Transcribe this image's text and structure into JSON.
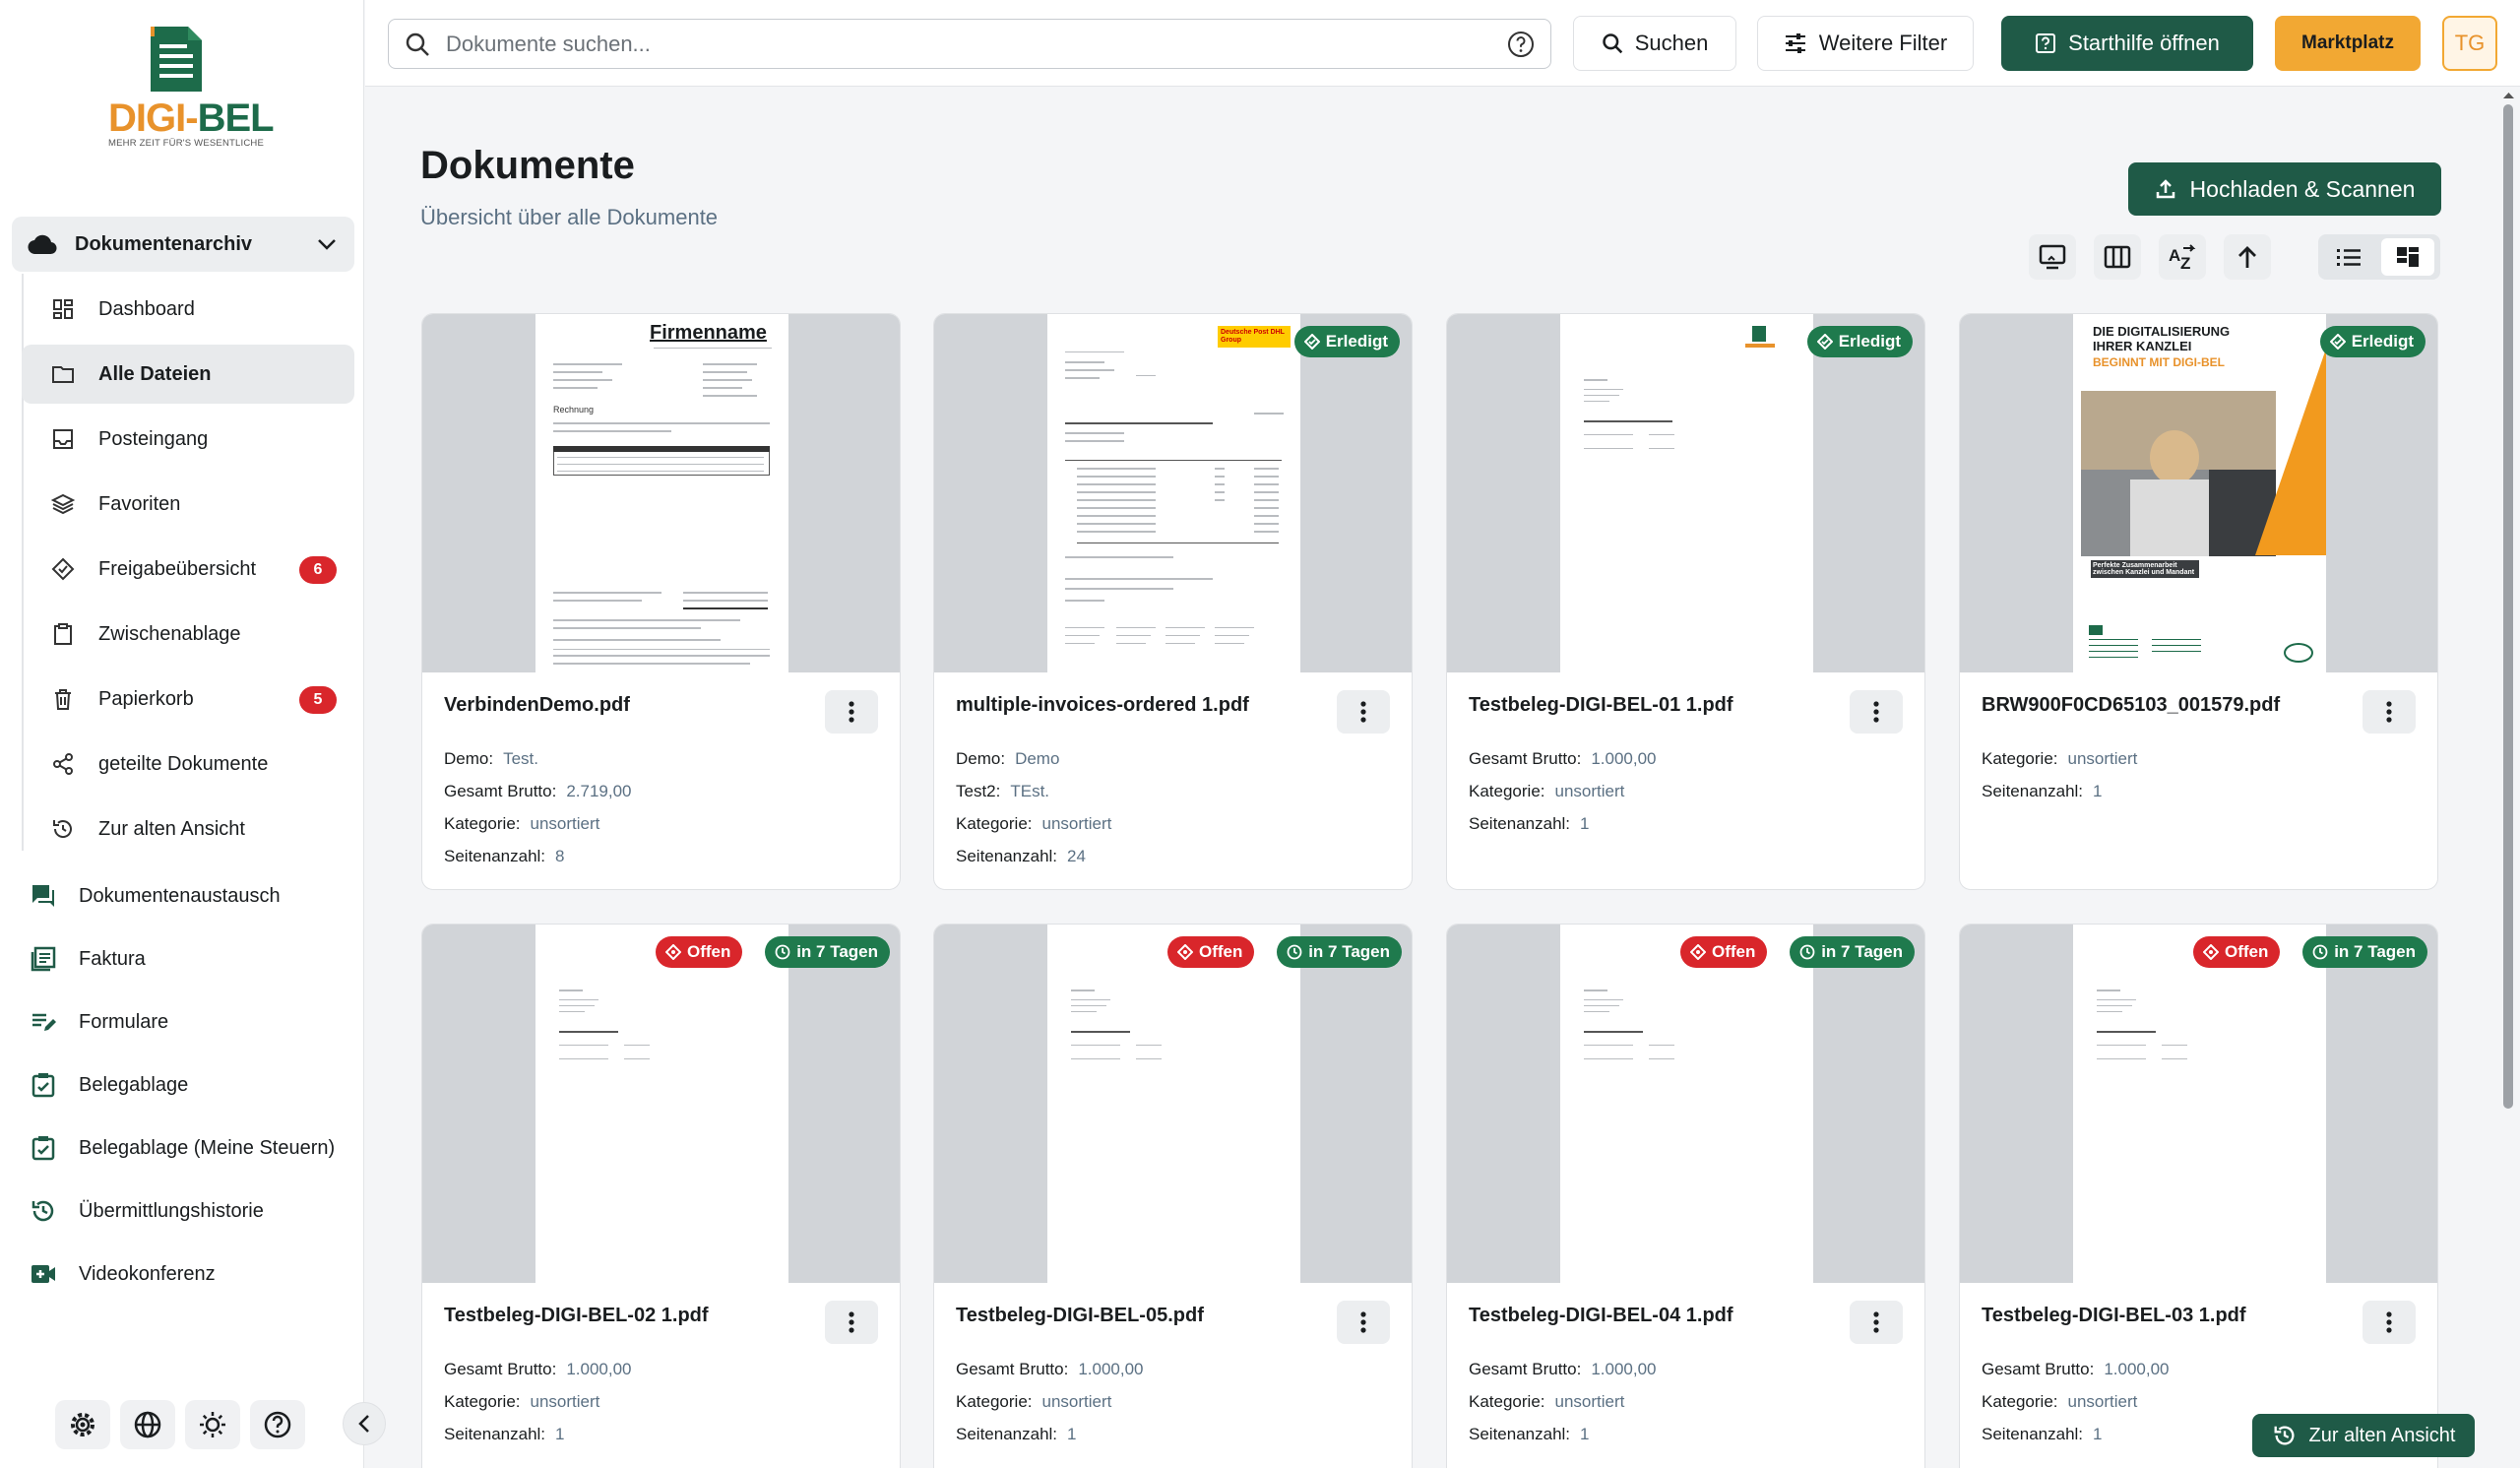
{
  "brand": {
    "logo_a": "DIGI",
    "logo_sep": "-",
    "logo_b": "BEL",
    "tagline": "MEHR ZEIT FÜR'S WESENTLICHE"
  },
  "sidebar": {
    "group": {
      "label": "Dokumentenarchiv",
      "icon": "cloud-icon"
    },
    "sub_items": [
      {
        "label": "Dashboard",
        "icon": "dashboard-icon"
      },
      {
        "label": "Alle Dateien",
        "icon": "folder-icon",
        "active": true
      },
      {
        "label": "Posteingang",
        "icon": "inbox-icon"
      },
      {
        "label": "Favoriten",
        "icon": "layers-icon"
      },
      {
        "label": "Freigabeübersicht",
        "icon": "tag-icon",
        "badge": "6"
      },
      {
        "label": "Zwischenablage",
        "icon": "clipboard-icon"
      },
      {
        "label": "Papierkorb",
        "icon": "trash-icon",
        "badge": "5"
      },
      {
        "label": "geteilte Dokumente",
        "icon": "share-icon"
      },
      {
        "label": "Zur alten Ansicht",
        "icon": "history-icon"
      }
    ],
    "top_items": [
      {
        "label": "Dokumentenaustausch",
        "icon": "chat-icon"
      },
      {
        "label": "Faktura",
        "icon": "invoice-icon"
      },
      {
        "label": "Formulare",
        "icon": "form-icon"
      },
      {
        "label": "Belegablage",
        "icon": "receipt-icon"
      },
      {
        "label": "Belegablage (Meine Steuern)",
        "icon": "receipt-icon"
      },
      {
        "label": "Übermittlungshistorie",
        "icon": "history-icon"
      },
      {
        "label": "Videokonferenz",
        "icon": "video-icon"
      }
    ]
  },
  "topbar": {
    "search_placeholder": "Dokumente suchen...",
    "search_button": "Suchen",
    "filter_button": "Weitere Filter",
    "help_button": "Starthilfe öffnen",
    "market_button": "Marktplatz",
    "avatar": "TG"
  },
  "main": {
    "title": "Dokumente",
    "subtitle": "Übersicht über alle Dokumente",
    "upload_button": "Hochladen & Scannen",
    "old_view_button": "Zur alten Ansicht"
  },
  "labels": {
    "done": "Erledigt",
    "open": "Offen",
    "due": "in 7 Tagen",
    "thumb_company": "Firmenname",
    "thumb_invoice": "Rechnung",
    "thumb_dhl": "Deutsche Post DHL Group",
    "flyer_title": "DIE DIGITALISIERUNG IHRER KANZLEI",
    "flyer_sub": "BEGINNT MIT DIGI-BEL",
    "flyer_foot": "Perfekte Zusammenarbeit zwischen Kanzlei und Mandant"
  },
  "documents": [
    {
      "name": "VerbindenDemo.pdf",
      "meta": [
        [
          "Demo:",
          "Test."
        ],
        [
          "Gesamt Brutto:",
          "2.719,00"
        ],
        [
          "Kategorie:",
          "unsortiert"
        ],
        [
          "Seitenanzahl:",
          "8"
        ]
      ]
    },
    {
      "name": "multiple-invoices-ordered 1.pdf",
      "meta": [
        [
          "Demo:",
          "Demo"
        ],
        [
          "Test2:",
          "TEst."
        ],
        [
          "Kategorie:",
          "unsortiert"
        ],
        [
          "Seitenanzahl:",
          "24"
        ]
      ]
    },
    {
      "name": "Testbeleg-DIGI-BEL-01 1.pdf",
      "meta": [
        [
          "Gesamt Brutto:",
          "1.000,00"
        ],
        [
          "Kategorie:",
          "unsortiert"
        ],
        [
          "Seitenanzahl:",
          "1"
        ]
      ]
    },
    {
      "name": "BRW900F0CD65103_001579.pdf",
      "meta": [
        [
          "Kategorie:",
          "unsortiert"
        ],
        [
          "Seitenanzahl:",
          "1"
        ]
      ]
    },
    {
      "name": "Testbeleg-DIGI-BEL-02 1.pdf",
      "meta": [
        [
          "Gesamt Brutto:",
          "1.000,00"
        ],
        [
          "Kategorie:",
          "unsortiert"
        ],
        [
          "Seitenanzahl:",
          "1"
        ]
      ]
    },
    {
      "name": "Testbeleg-DIGI-BEL-05.pdf",
      "meta": [
        [
          "Gesamt Brutto:",
          "1.000,00"
        ],
        [
          "Kategorie:",
          "unsortiert"
        ],
        [
          "Seitenanzahl:",
          "1"
        ]
      ]
    },
    {
      "name": "Testbeleg-DIGI-BEL-04 1.pdf",
      "meta": [
        [
          "Gesamt Brutto:",
          "1.000,00"
        ],
        [
          "Kategorie:",
          "unsortiert"
        ],
        [
          "Seitenanzahl:",
          "1"
        ]
      ]
    },
    {
      "name": "Testbeleg-DIGI-BEL-03 1.pdf",
      "meta": [
        [
          "Gesamt Brutto:",
          "1.000,00"
        ],
        [
          "Kategorie:",
          "unsortiert"
        ],
        [
          "Seitenanzahl:",
          "1"
        ]
      ]
    }
  ],
  "colors": {
    "primary": "#1f5a47",
    "accent": "#f2a833",
    "danger": "#d9262b",
    "success": "#1f7a4d"
  }
}
